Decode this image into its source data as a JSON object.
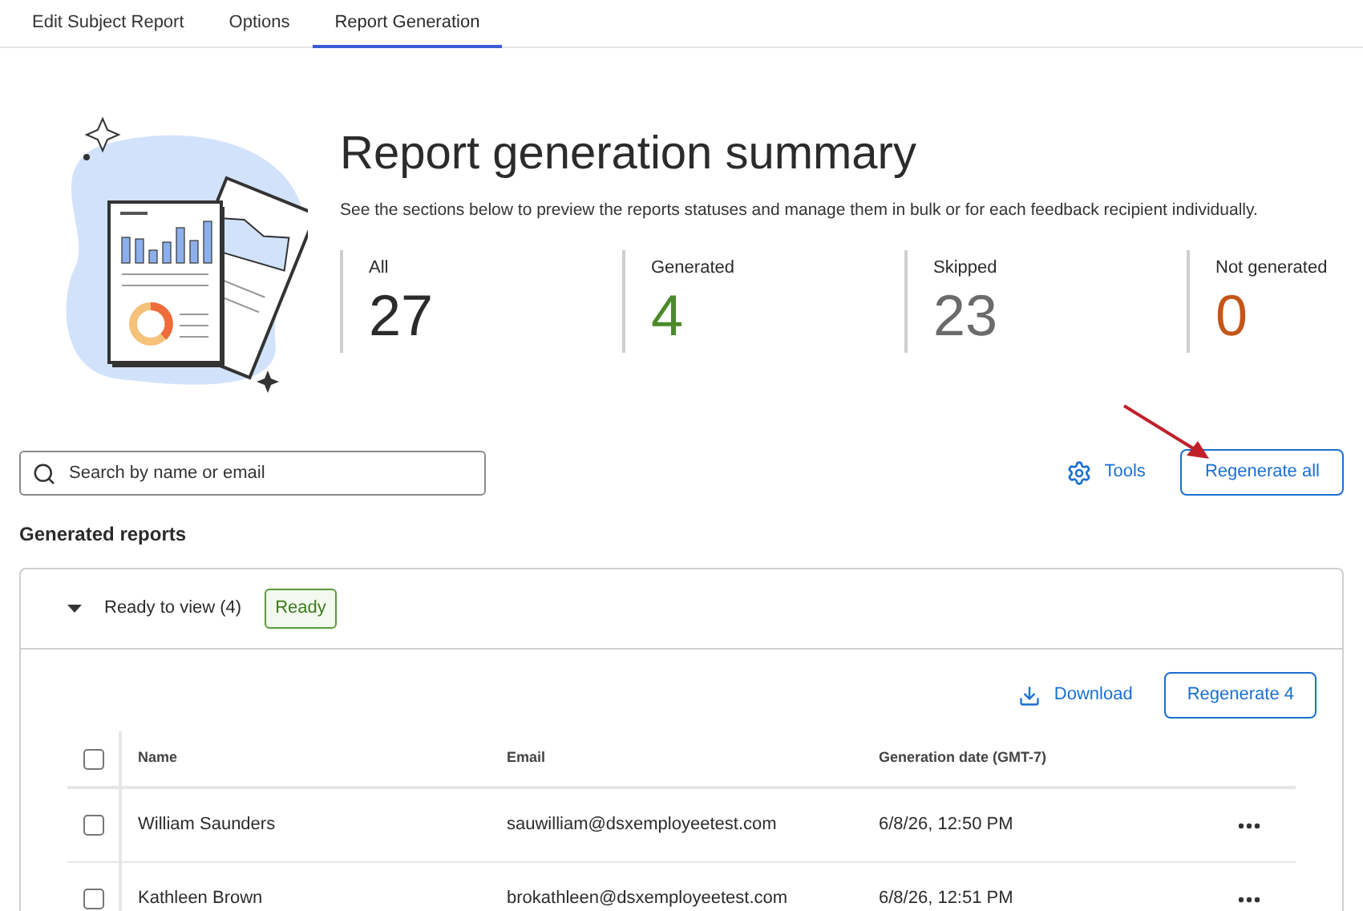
{
  "tabs": [
    {
      "label": "Edit Subject Report",
      "selected": false
    },
    {
      "label": "Options",
      "selected": false
    },
    {
      "label": "Report Generation",
      "selected": true
    }
  ],
  "summary": {
    "title": "Report generation summary",
    "description": "See the sections below to preview the reports statuses and manage them in bulk or for each feedback recipient individually.",
    "stats": [
      {
        "label": "All",
        "value": "27",
        "color": "#2b2b2b"
      },
      {
        "label": "Generated",
        "value": "4",
        "color": "#4a8a2a"
      },
      {
        "label": "Skipped",
        "value": "23",
        "color": "#6b6b6b"
      },
      {
        "label": "Not generated",
        "value": "0",
        "color": "#c4561a"
      }
    ]
  },
  "toolbar": {
    "search_placeholder": "Search by name or email",
    "tools": "Tools",
    "regenerate_all": "Regenerate all"
  },
  "section_title": "Generated reports",
  "group": {
    "title": "Ready to view (4)",
    "expanded": true,
    "badge": "Ready",
    "download": "Download",
    "regenerate": "Regenerate 4",
    "columns": [
      "Name",
      "Email",
      "Generation date (GMT-7)"
    ],
    "all_checked": false,
    "rows": [
      {
        "name": "William Saunders",
        "email": "sauwilliam@dsxemployeetest.com",
        "date": "6/8/26, 12:50 PM",
        "checked": false
      },
      {
        "name": "Kathleen Brown",
        "email": "brokathleen@dsxemployeetest.com",
        "date": "6/8/26, 12:51 PM",
        "checked": false
      }
    ]
  }
}
